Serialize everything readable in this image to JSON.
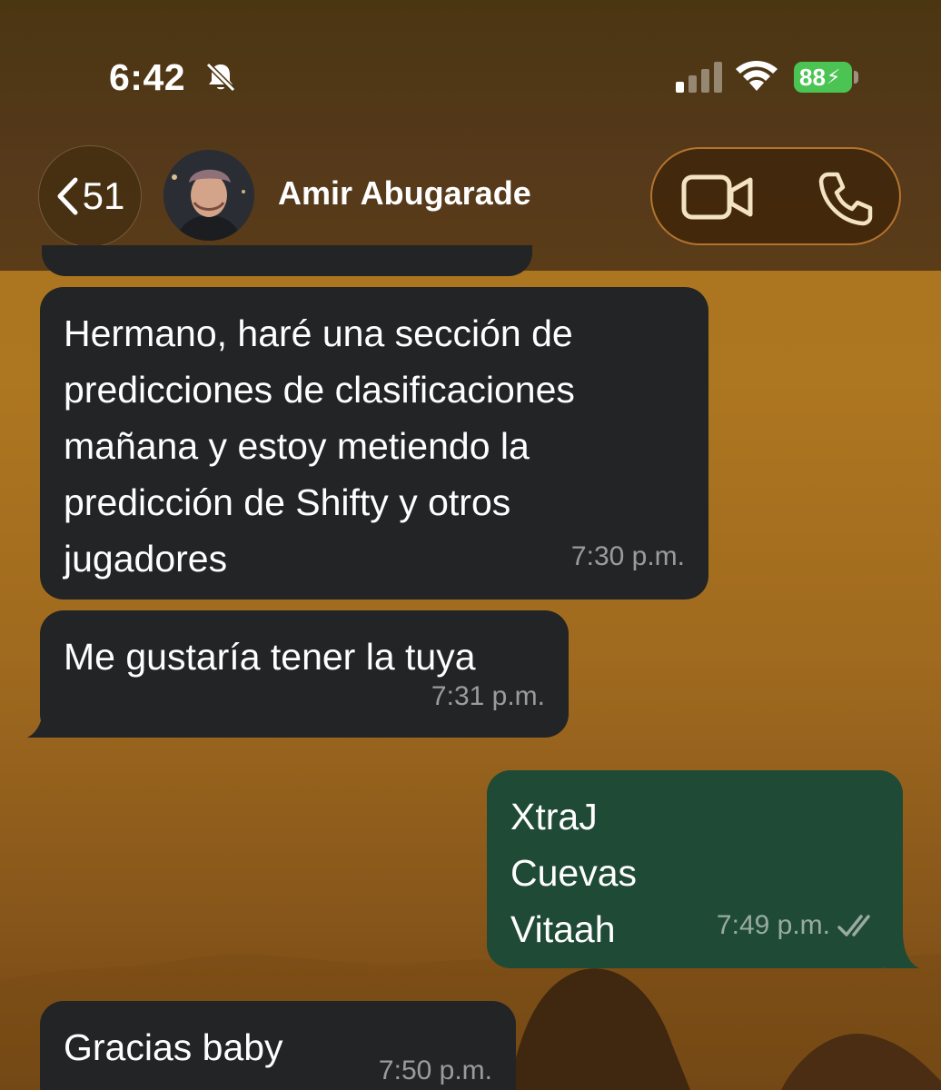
{
  "status_bar": {
    "time": "6:42",
    "battery": "88",
    "icons": [
      "bell-slash-icon",
      "signal-icon",
      "wifi-icon",
      "battery-charging-icon"
    ]
  },
  "header": {
    "back_count": "51",
    "contact_name": "Amir Abugarade",
    "icons": [
      "chevron-left-icon",
      "video-call-icon",
      "phone-icon"
    ]
  },
  "messages": [
    {
      "direction": "incoming",
      "text": "Hermano, haré una sección de\npredicciones de clasificaciones\nmañana y estoy metiendo la\npredicción de Shifty y otros\njugadores",
      "time": "7:30 p.m."
    },
    {
      "direction": "incoming",
      "text": "Me gustaría tener la tuya",
      "time": "7:31 p.m."
    },
    {
      "direction": "outgoing",
      "text": "XtraJ\nCuevas\nVitaah",
      "time": "7:49 p.m.",
      "status": "read"
    },
    {
      "direction": "incoming",
      "text": "Gracias baby",
      "time": "7:50 p.m."
    }
  ],
  "colors": {
    "incoming_bubble": "#222426",
    "outgoing_bubble": "#1f4a35",
    "wallpaper": "#a9731f",
    "battery": "#4cc453"
  }
}
